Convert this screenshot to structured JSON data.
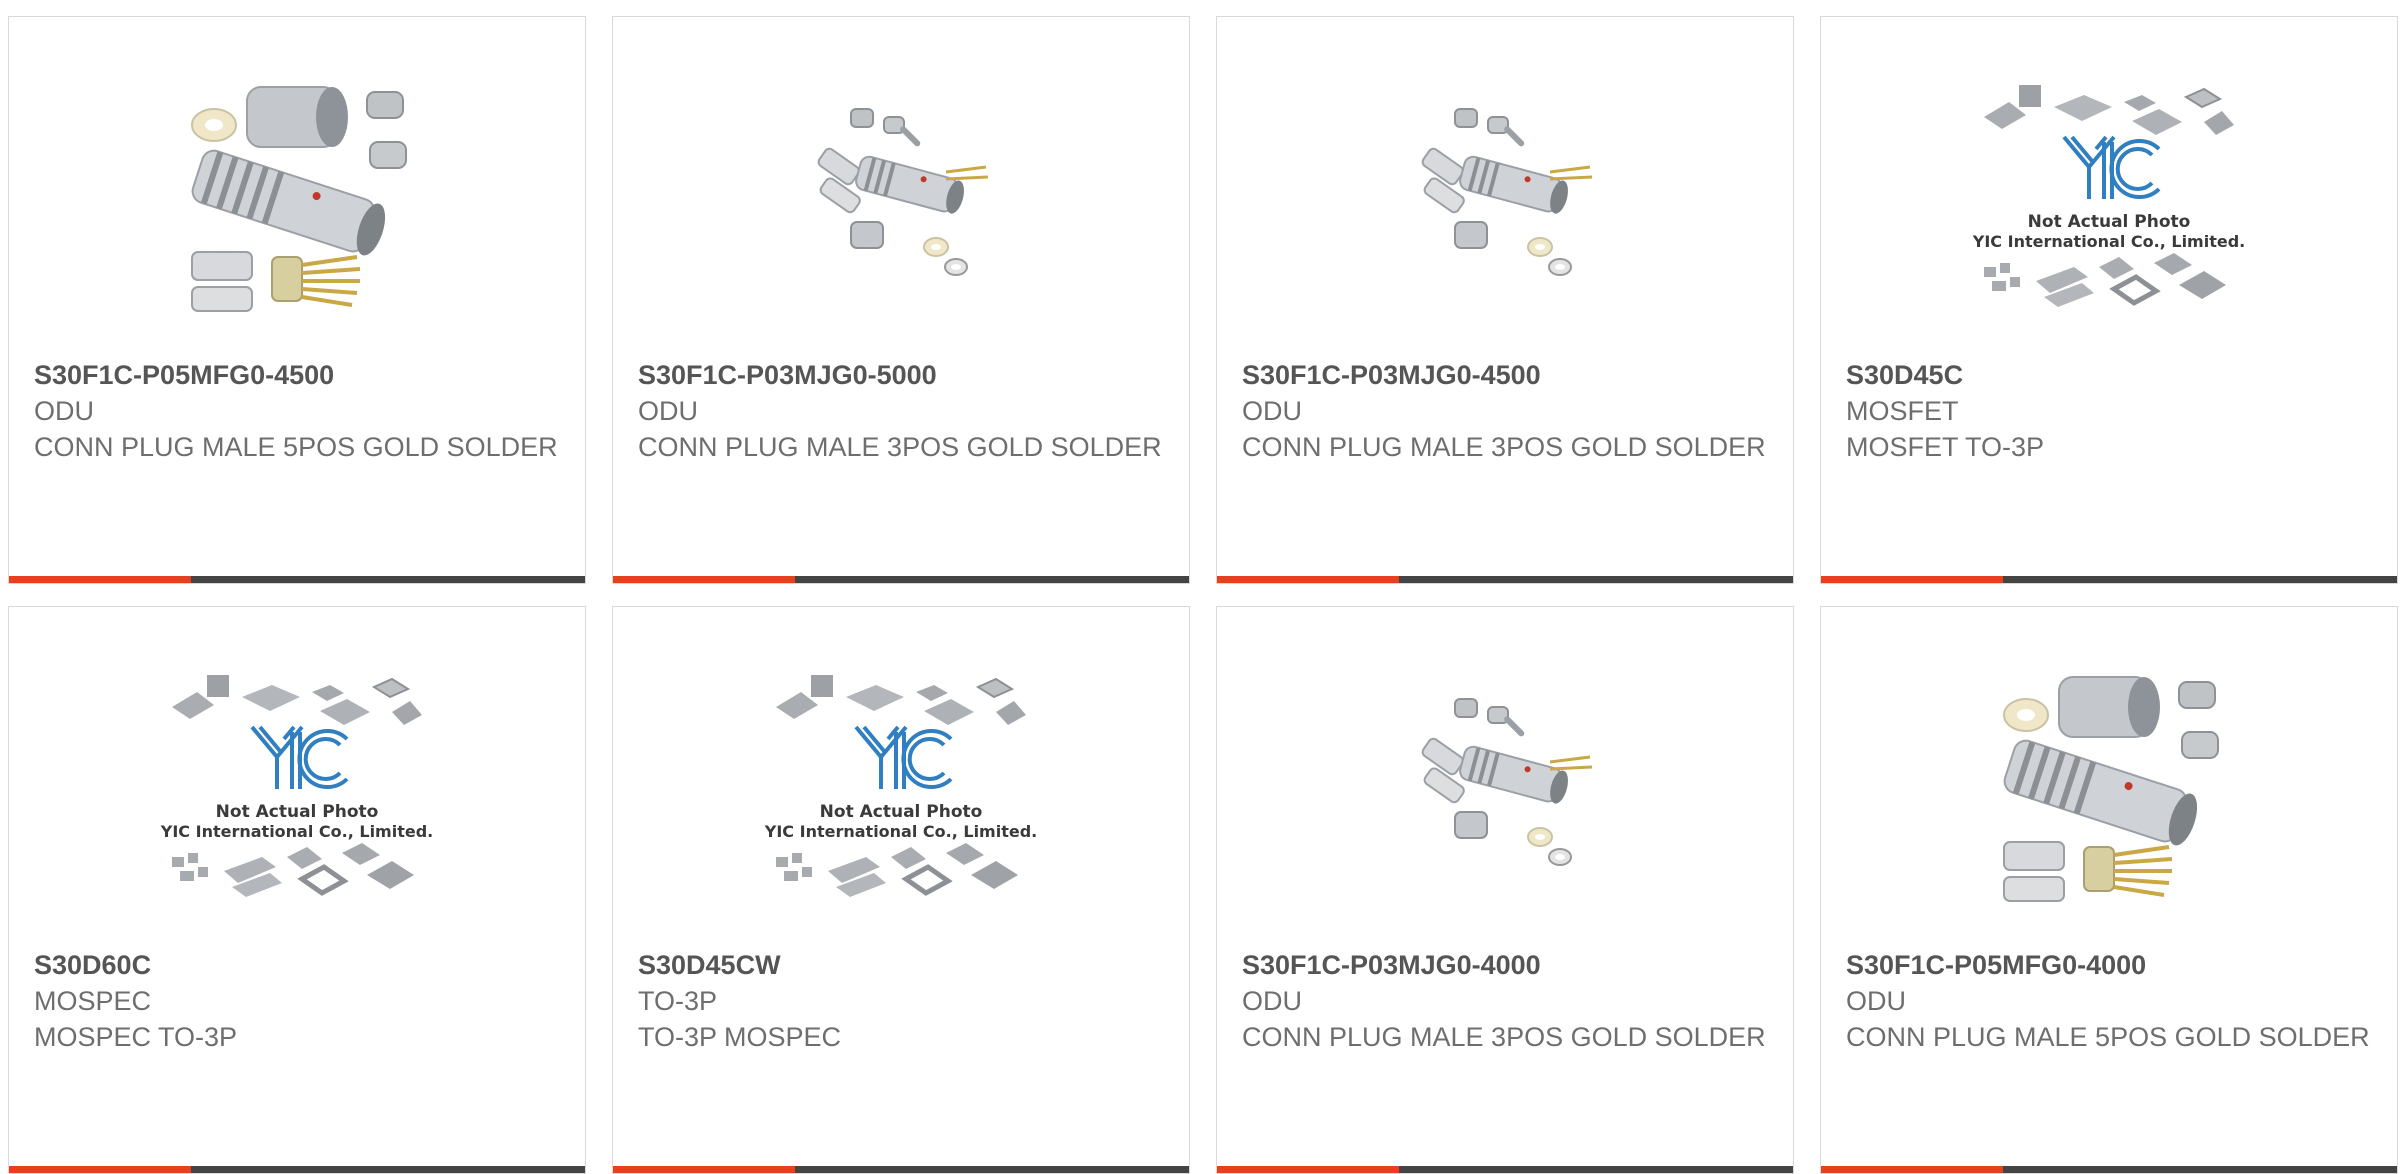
{
  "products": [
    {
      "part": "S30F1C-P05MFG0-4500",
      "manufacturer": "ODU",
      "description": "CONN PLUG MALE 5POS GOLD SOLDER",
      "image": "connector-5pos-icon"
    },
    {
      "part": "S30F1C-P03MJG0-5000",
      "manufacturer": "ODU",
      "description": "CONN PLUG MALE 3POS GOLD SOLDER",
      "image": "connector-3pos-icon"
    },
    {
      "part": "S30F1C-P03MJG0-4500",
      "manufacturer": "ODU",
      "description": "CONN PLUG MALE 3POS GOLD SOLDER",
      "image": "connector-3pos-icon"
    },
    {
      "part": "S30D45C",
      "manufacturer": "MOSFET",
      "description": "MOSFET TO-3P",
      "image": "placeholder-photo",
      "placeholder_line1": "Not Actual Photo",
      "placeholder_line2": "YIC International Co., Limited.",
      "placeholder_logo": "YIC"
    },
    {
      "part": "S30D60C",
      "manufacturer": "MOSPEC",
      "description": "MOSPEC TO-3P",
      "image": "placeholder-photo",
      "placeholder_line1": "Not Actual Photo",
      "placeholder_line2": "YIC International Co., Limited.",
      "placeholder_logo": "YIC"
    },
    {
      "part": "S30D45CW",
      "manufacturer": "TO-3P",
      "description": "TO-3P MOSPEC",
      "image": "placeholder-photo",
      "placeholder_line1": "Not Actual Photo",
      "placeholder_line2": "YIC International Co., Limited.",
      "placeholder_logo": "YIC"
    },
    {
      "part": "S30F1C-P03MJG0-4000",
      "manufacturer": "ODU",
      "description": "CONN PLUG MALE 3POS GOLD SOLDER",
      "image": "connector-3pos-icon"
    },
    {
      "part": "S30F1C-P05MFG0-4000",
      "manufacturer": "ODU",
      "description": "CONN PLUG MALE 5POS GOLD SOLDER",
      "image": "connector-5pos-icon"
    }
  ],
  "colors": {
    "accent": "#e8401c",
    "bar": "#444444",
    "part_text": "#555555",
    "body_text": "#6e6e6e",
    "border": "#d9d9d9"
  }
}
